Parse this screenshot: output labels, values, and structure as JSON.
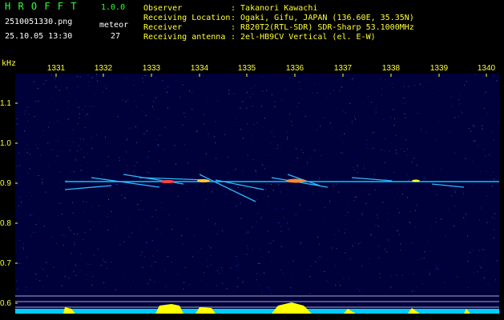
{
  "app": {
    "title": "H R O F F T",
    "version": "1.0.0",
    "filename": "2510051330.png",
    "datetime": "25.10.05 13:30",
    "meteor_label": "meteor",
    "meteor_count": "27"
  },
  "info": {
    "observer_label": "Observer",
    "observer_value": ": Takanori Kawachi",
    "location_label": "Receiving Location",
    "location_value": ": Ogaki, Gifu, JAPAN (136.60E, 35.35N)",
    "receiver_label": "Receiver",
    "receiver_value": ": R820T2(RTL-SDR) SDR-Sharp 53.1000MHz",
    "antenna_label": "Receiving antenna",
    "antenna_value": ": 2el-HB9CV Vertical (el. E-W)"
  },
  "axes": {
    "x_unit": "kHz",
    "x_ticks": [
      "1331",
      "1332",
      "1333",
      "1334",
      "1335",
      "1336",
      "1337",
      "1338",
      "1339",
      "1340"
    ],
    "y_ticks": [
      "1.1",
      "1.0",
      "0.9",
      "0.8",
      "0.7",
      "0.6"
    ]
  },
  "colors": {
    "background": "#000000",
    "plot_background": "#00003a",
    "header_green": "#33ff33",
    "label_yellow": "#ffff33",
    "trace_cyan": "#00ccff",
    "histogram_yellow": "#ffff00"
  }
}
